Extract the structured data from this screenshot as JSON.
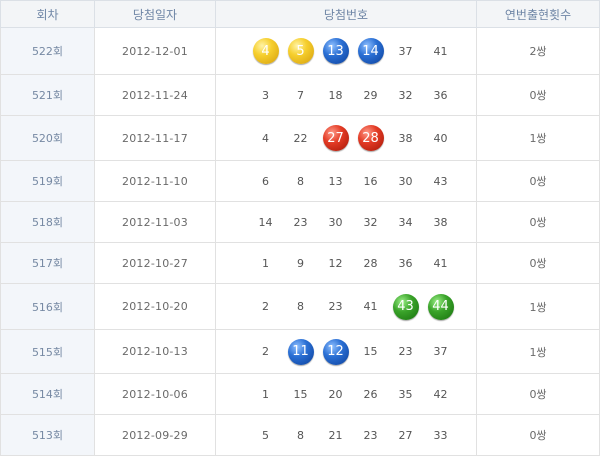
{
  "headers": {
    "round": "회차",
    "date": "당첨일자",
    "numbers": "당첨번호",
    "count": "연번출현횟수"
  },
  "colors": {
    "yellow": "#f6cf2e",
    "blue": "#2a6fd4",
    "red": "#e33b25",
    "green": "#3aa32a"
  },
  "rows": [
    {
      "round": "522회",
      "date": "2012-12-01",
      "count": "2쌍",
      "numbers": [
        {
          "v": "4",
          "ball": "yellow"
        },
        {
          "v": "5",
          "ball": "yellow"
        },
        {
          "v": "13",
          "ball": "blue"
        },
        {
          "v": "14",
          "ball": "blue"
        },
        {
          "v": "37",
          "ball": ""
        },
        {
          "v": "41",
          "ball": ""
        }
      ]
    },
    {
      "round": "521회",
      "date": "2012-11-24",
      "count": "0쌍",
      "numbers": [
        {
          "v": "3",
          "ball": ""
        },
        {
          "v": "7",
          "ball": ""
        },
        {
          "v": "18",
          "ball": ""
        },
        {
          "v": "29",
          "ball": ""
        },
        {
          "v": "32",
          "ball": ""
        },
        {
          "v": "36",
          "ball": ""
        }
      ]
    },
    {
      "round": "520회",
      "date": "2012-11-17",
      "count": "1쌍",
      "numbers": [
        {
          "v": "4",
          "ball": ""
        },
        {
          "v": "22",
          "ball": ""
        },
        {
          "v": "27",
          "ball": "red"
        },
        {
          "v": "28",
          "ball": "red"
        },
        {
          "v": "38",
          "ball": ""
        },
        {
          "v": "40",
          "ball": ""
        }
      ]
    },
    {
      "round": "519회",
      "date": "2012-11-10",
      "count": "0쌍",
      "numbers": [
        {
          "v": "6",
          "ball": ""
        },
        {
          "v": "8",
          "ball": ""
        },
        {
          "v": "13",
          "ball": ""
        },
        {
          "v": "16",
          "ball": ""
        },
        {
          "v": "30",
          "ball": ""
        },
        {
          "v": "43",
          "ball": ""
        }
      ]
    },
    {
      "round": "518회",
      "date": "2012-11-03",
      "count": "0쌍",
      "numbers": [
        {
          "v": "14",
          "ball": ""
        },
        {
          "v": "23",
          "ball": ""
        },
        {
          "v": "30",
          "ball": ""
        },
        {
          "v": "32",
          "ball": ""
        },
        {
          "v": "34",
          "ball": ""
        },
        {
          "v": "38",
          "ball": ""
        }
      ]
    },
    {
      "round": "517회",
      "date": "2012-10-27",
      "count": "0쌍",
      "numbers": [
        {
          "v": "1",
          "ball": ""
        },
        {
          "v": "9",
          "ball": ""
        },
        {
          "v": "12",
          "ball": ""
        },
        {
          "v": "28",
          "ball": ""
        },
        {
          "v": "36",
          "ball": ""
        },
        {
          "v": "41",
          "ball": ""
        }
      ]
    },
    {
      "round": "516회",
      "date": "2012-10-20",
      "count": "1쌍",
      "numbers": [
        {
          "v": "2",
          "ball": ""
        },
        {
          "v": "8",
          "ball": ""
        },
        {
          "v": "23",
          "ball": ""
        },
        {
          "v": "41",
          "ball": ""
        },
        {
          "v": "43",
          "ball": "green"
        },
        {
          "v": "44",
          "ball": "green"
        }
      ]
    },
    {
      "round": "515회",
      "date": "2012-10-13",
      "count": "1쌍",
      "numbers": [
        {
          "v": "2",
          "ball": ""
        },
        {
          "v": "11",
          "ball": "blue"
        },
        {
          "v": "12",
          "ball": "blue"
        },
        {
          "v": "15",
          "ball": ""
        },
        {
          "v": "23",
          "ball": ""
        },
        {
          "v": "37",
          "ball": ""
        }
      ]
    },
    {
      "round": "514회",
      "date": "2012-10-06",
      "count": "0쌍",
      "numbers": [
        {
          "v": "1",
          "ball": ""
        },
        {
          "v": "15",
          "ball": ""
        },
        {
          "v": "20",
          "ball": ""
        },
        {
          "v": "26",
          "ball": ""
        },
        {
          "v": "35",
          "ball": ""
        },
        {
          "v": "42",
          "ball": ""
        }
      ]
    },
    {
      "round": "513회",
      "date": "2012-09-29",
      "count": "0쌍",
      "numbers": [
        {
          "v": "5",
          "ball": ""
        },
        {
          "v": "8",
          "ball": ""
        },
        {
          "v": "21",
          "ball": ""
        },
        {
          "v": "23",
          "ball": ""
        },
        {
          "v": "27",
          "ball": ""
        },
        {
          "v": "33",
          "ball": ""
        }
      ]
    }
  ]
}
